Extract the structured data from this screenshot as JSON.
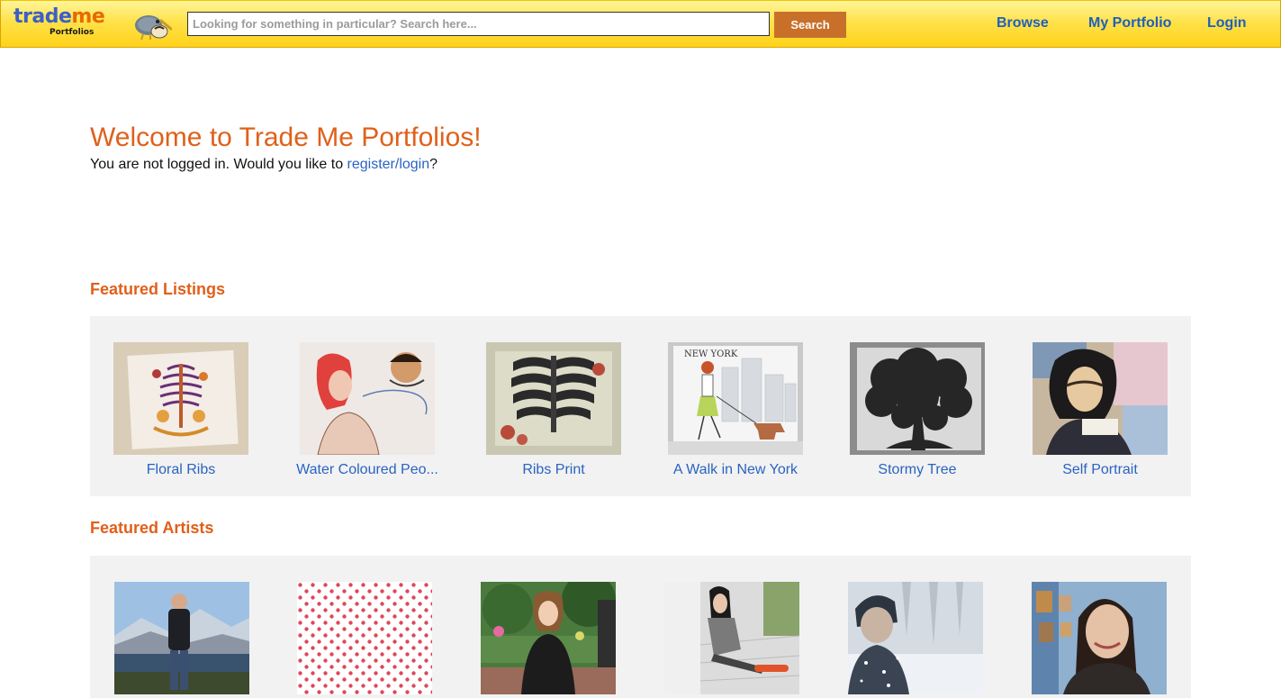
{
  "header": {
    "logo": {
      "word_trade": "trade",
      "word_me": "me",
      "sub": "Portfolios"
    },
    "search": {
      "placeholder": "Looking for something in particular? Search here...",
      "value": "",
      "button_label": "Search"
    },
    "nav": {
      "browse": "Browse",
      "my_portfolio": "My Portfolio",
      "login": "Login"
    }
  },
  "welcome": {
    "title": "Welcome to Trade Me Portfolios!",
    "text_before": "You are not logged in. Would you like to ",
    "link": "register/login",
    "text_after": "?"
  },
  "featured_listings": {
    "title": "Featured Listings",
    "items": [
      {
        "caption": "Floral Ribs"
      },
      {
        "caption": "Water Coloured Peo..."
      },
      {
        "caption": "Ribs Print"
      },
      {
        "caption": "A Walk in New York"
      },
      {
        "caption": "Stormy Tree"
      },
      {
        "caption": "Self Portrait"
      }
    ]
  },
  "featured_artists": {
    "title": "Featured Artists",
    "items": [
      {},
      {},
      {},
      {},
      {},
      {}
    ]
  },
  "colors": {
    "header_yellow": "#ffd21a",
    "accent_orange": "#e0601a",
    "search_button": "#c8702a",
    "link_blue": "#2a63c1",
    "panel_grey": "#f2f2f2"
  }
}
